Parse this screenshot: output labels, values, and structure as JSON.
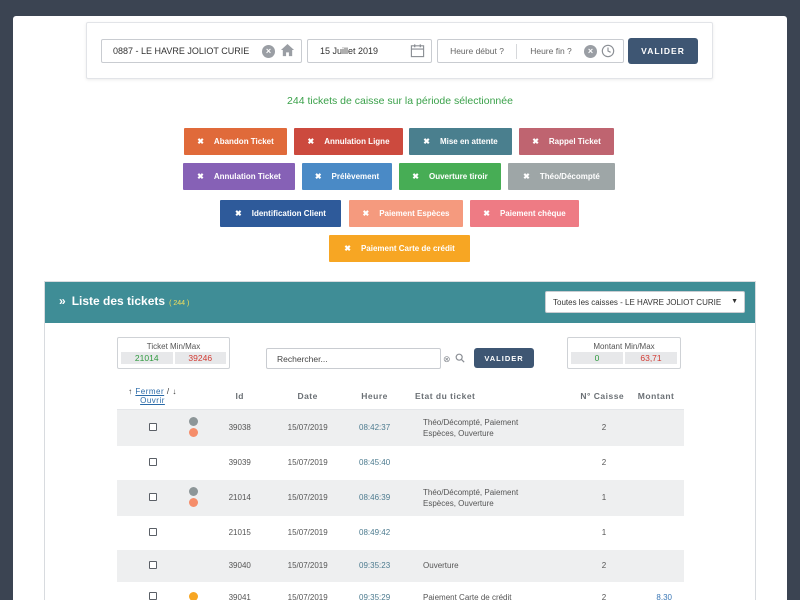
{
  "filters": {
    "store": "0887 - LE HAVRE JOLIOT CURIE",
    "date": "15 Juillet 2019",
    "hour_start_placeholder": "Heure début ?",
    "hour_end_placeholder": "Heure fin ?",
    "validate_label": "VALIDER"
  },
  "summary_text": "244 tickets de caisse sur la période sélectionnée",
  "tags": [
    {
      "label": "Abandon Ticket",
      "color": "#e06a3a"
    },
    {
      "label": "Annulation Ligne",
      "color": "#cc4a3e"
    },
    {
      "label": "Mise en attente",
      "color": "#4a7f8e"
    },
    {
      "label": "Rappel Ticket",
      "color": "#bf6470"
    },
    {
      "label": "Annulation Ticket",
      "color": "#8661b6"
    },
    {
      "label": "Prélèvement",
      "color": "#4a8ac6"
    },
    {
      "label": "Ouverture tiroir",
      "color": "#47ad55"
    },
    {
      "label": "Théo/Décompté",
      "color": "#9ea6a7"
    },
    {
      "label": "Identification Client",
      "color": "#2e5a9a"
    },
    {
      "label": "Paiement Espèces",
      "color": "#f59a7e"
    },
    {
      "label": "Paiement chèque",
      "color": "#ee7b84"
    },
    {
      "label": "Paiement Carte de crédit",
      "color": "#f7a623"
    }
  ],
  "panel": {
    "title": "Liste des tickets",
    "count": "( 244 )",
    "caisse_select": "Toutes les caisses - LE HAVRE JOLIOT CURIE",
    "ticket_minmax": {
      "label": "Ticket Min/Max",
      "min": "21014",
      "max": "39246"
    },
    "montant_minmax": {
      "label": "Montant Min/Max",
      "min": "0",
      "max": "63,71"
    },
    "search_placeholder": "Rechercher...",
    "search_validate": "VALIDER"
  },
  "table": {
    "fermer": "Fermer",
    "ouvrir": "Ouvrir",
    "headers": {
      "id": "Id",
      "date": "Date",
      "heure": "Heure",
      "etat": "Etat du ticket",
      "caisse": "N° Caisse",
      "montant": "Montant"
    },
    "rows": [
      {
        "id": "39038",
        "date": "15/07/2019",
        "heure": "08:42:37",
        "etat": "Théo/Décompté, Paiement Espèces, Ouverture",
        "caisse": "2",
        "montant": "",
        "dots": [
          "#8d9698",
          "#f58d6a"
        ]
      },
      {
        "id": "39039",
        "date": "15/07/2019",
        "heure": "08:45:40",
        "etat": "",
        "caisse": "2",
        "montant": "",
        "dots": []
      },
      {
        "id": "21014",
        "date": "15/07/2019",
        "heure": "08:46:39",
        "etat": "Théo/Décompté, Paiement Espèces, Ouverture",
        "caisse": "1",
        "montant": "",
        "dots": [
          "#8d9698",
          "#f58d6a"
        ]
      },
      {
        "id": "21015",
        "date": "15/07/2019",
        "heure": "08:49:42",
        "etat": "",
        "caisse": "1",
        "montant": "",
        "dots": []
      },
      {
        "id": "39040",
        "date": "15/07/2019",
        "heure": "09:35:23",
        "etat": "Ouverture",
        "caisse": "2",
        "montant": "",
        "dots": []
      },
      {
        "id": "39041",
        "date": "15/07/2019",
        "heure": "09:35:29",
        "etat": "Paiement Carte de crédit",
        "caisse": "2",
        "montant": "8,30",
        "dots": [
          "#f7a623"
        ]
      }
    ]
  }
}
